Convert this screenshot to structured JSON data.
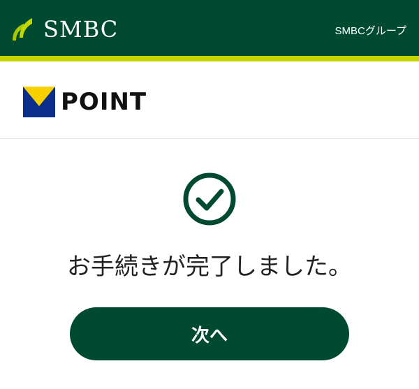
{
  "header": {
    "brand_name": "SMBC",
    "group_label": "SMBCグループ",
    "leaf_icon": "smbc-leaf-logo",
    "bg_color": "#004a32",
    "stripe_color": "#c3d600"
  },
  "brand": {
    "name": "POINT",
    "mark_icon": "v-point-mark",
    "mark_colors": [
      "#0b2e8a",
      "#f7d000"
    ]
  },
  "status": {
    "icon": "check-circle-icon",
    "message": "お手続きが完了しました。"
  },
  "actions": {
    "next_label": "次へ",
    "button_color": "#004a32"
  }
}
